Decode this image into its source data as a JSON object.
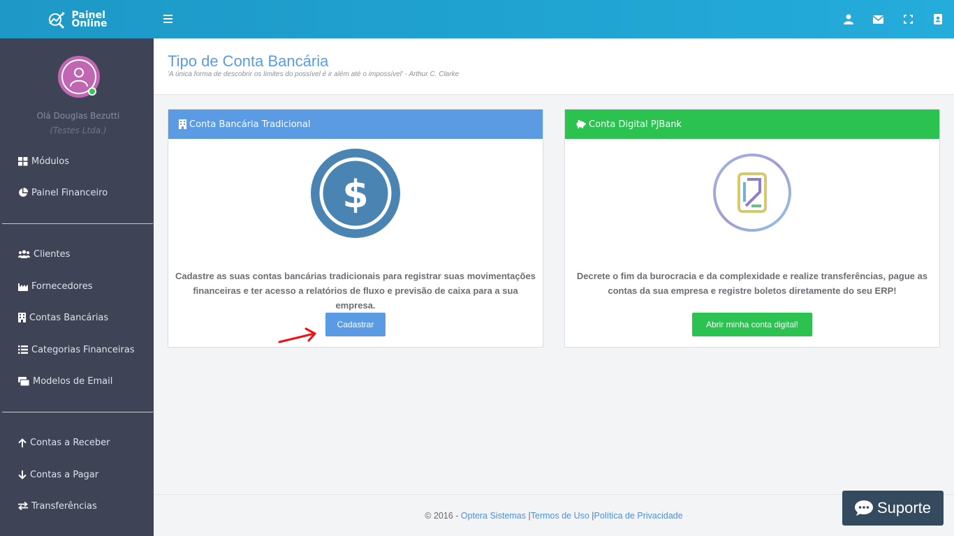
{
  "brand": {
    "line1": "Painel",
    "line2": "Online"
  },
  "topbar": {
    "icons": [
      "user-icon",
      "envelope-icon",
      "fullscreen-icon",
      "address-book-icon"
    ]
  },
  "user": {
    "greeting": "Olá Douglas Bezutti",
    "company": "(Testes Ltda.)"
  },
  "sidebar": {
    "group1": [
      {
        "label": "Módulos",
        "icon": "grid-icon"
      },
      {
        "label": "Painel Financeiro",
        "icon": "pie-chart-icon"
      }
    ],
    "group2": [
      {
        "label": "Clientes",
        "icon": "users-icon"
      },
      {
        "label": "Fornecedores",
        "icon": "industry-icon"
      },
      {
        "label": "Contas Bancárias",
        "icon": "building-icon"
      },
      {
        "label": "Categorias Financeiras",
        "icon": "list-icon"
      },
      {
        "label": "Modelos de Email",
        "icon": "envelope-stack-icon"
      }
    ],
    "group3": [
      {
        "label": "Contas a Receber",
        "icon": "arrow-up-icon"
      },
      {
        "label": "Contas a Pagar",
        "icon": "arrow-down-icon"
      },
      {
        "label": "Transferências",
        "icon": "exchange-icon"
      }
    ]
  },
  "page": {
    "title": "Tipo de Conta Bancária",
    "quote": "'A única forma de descobrir os limites do possível é ir além até o impossível' - Arthur C. Clarke"
  },
  "cards": [
    {
      "header": "Conta Bancária Tradicional",
      "header_color": "#5b9be3",
      "text_line1": "Cadastre as suas contas bancárias tradicionais para registrar suas movimentações",
      "text_line2": "financeiras e ter acesso a relatórios de fluxo e previsão de caixa para a sua empresa.",
      "button": "Cadastrar",
      "button_color": "#5b9be3"
    },
    {
      "header": "Conta Digital PJBank",
      "header_color": "#2bc24f",
      "text_line1": "Decrete o fim da burocracia e da complexidade e realize transferências, pague as",
      "text_line2": "contas da sua empresa e registre boletos diretamente do seu ERP!",
      "button": "Abrir minha conta digital!",
      "button_color": "#2bc24f"
    }
  ],
  "footer": {
    "copyright": "© 2016 -",
    "company_link": "Optera Sistemas",
    "sep": "|",
    "terms_link": "Termos de Uso",
    "privacy_link": "Política de Privacidade"
  },
  "support": {
    "label": "Suporte"
  }
}
